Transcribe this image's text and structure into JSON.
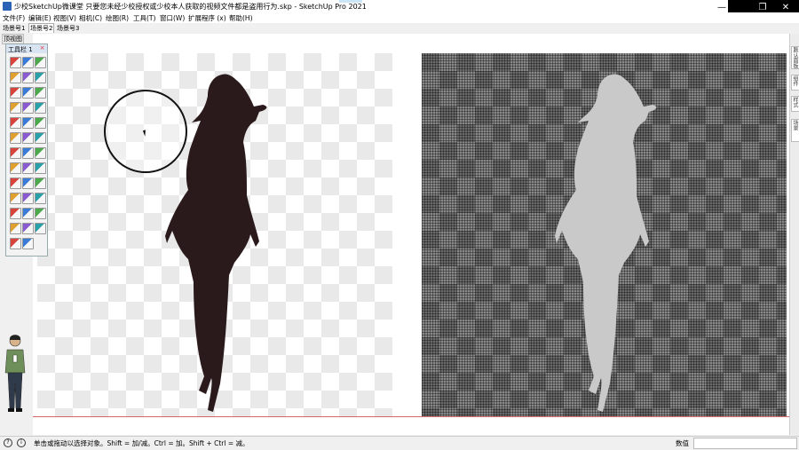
{
  "window": {
    "title": "少校SketchUp微课堂 只要您未经少校授权或少校本人获取的视频文件都是盗用行为.skp - SketchUp Pro 2021",
    "controls": {
      "minimize": "—",
      "maximize": "❐",
      "close": "✕"
    }
  },
  "menu": [
    "文件(F)",
    "编辑(E)",
    "视图(V)",
    "相机(C)",
    "绘图(R)",
    "工具(T)",
    "窗口(W)",
    "扩展程序 (x)",
    "帮助(H)"
  ],
  "scenes": [
    "场景号1",
    "场景号2",
    "场景号3"
  ],
  "viewport": {
    "label": "顶视图"
  },
  "toolbar": {
    "title": "工具栏 1",
    "close": "×",
    "tools": [
      [
        "select-tool",
        "eraser-tool",
        "paint-bucket-tool"
      ],
      [
        "lasso-tool",
        "rectangle-tool",
        "pencil-tool"
      ],
      [
        "line-tool",
        "arc-tool",
        "offset-tool"
      ],
      [
        "push-pull-tool",
        "follow-me-tool",
        "move-tool"
      ],
      [
        "tape-measure-tool",
        "dimension-tool",
        "protractor-tool"
      ],
      [
        "orbit-tool",
        "pan-tool",
        "zoom-tool"
      ],
      [
        "section-tool",
        "walk-tool",
        "look-around-tool"
      ],
      [
        "add-location-tool",
        "photo-texture-tool",
        "terrain-tool"
      ],
      [
        "sandbox-smoove-tool",
        "sandbox-stamp-tool",
        "sandbox-drape-tool"
      ],
      [
        "view-iso-tool",
        "view-top-tool",
        "view-front-tool"
      ],
      [
        "view-right-tool",
        "view-back-tool",
        "view-left-tool"
      ],
      [
        "material-tool",
        "axes-tool",
        "components-tool"
      ],
      [
        "styles-tool",
        "layers-tool"
      ]
    ]
  },
  "right_tray": [
    "默认面板",
    "组件",
    "样式",
    "场景"
  ],
  "status": {
    "text": "单击或拖动以选择对象。Shift = 加/减。Ctrl = 加。Shift + Ctrl = 减。",
    "measure_label": "数值",
    "measure_value": ""
  },
  "colors": {
    "silhouette": "#2a1a1c",
    "silhouette_gray": "#c9c9c9",
    "accent": "#2a63b6"
  }
}
